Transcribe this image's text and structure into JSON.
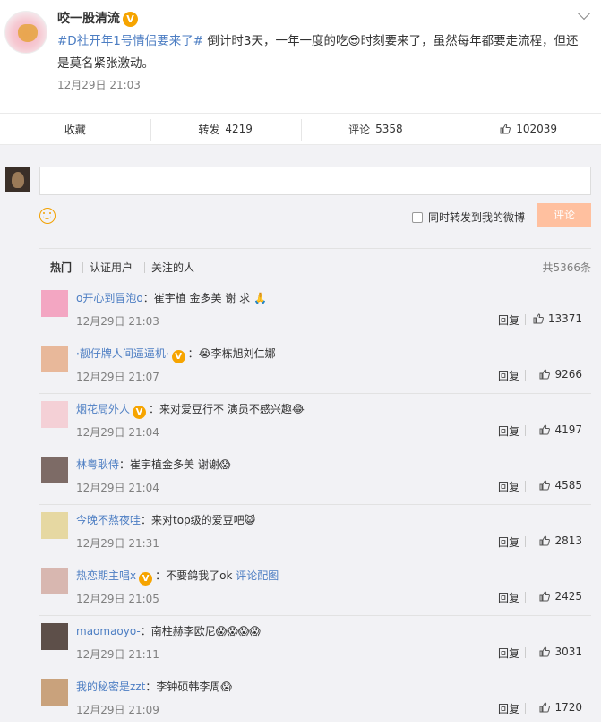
{
  "post": {
    "author": "咬一股清流",
    "verified_badge": "V",
    "hashtag": "#D社开年1号情侣要来了#",
    "text": " 倒计时3天，一年一度的吃😎时刻要来了，虽然每年都要走流程，但还是莫名紧张激动。",
    "time": "12月29日 21:03"
  },
  "actions": {
    "favorite": "收藏",
    "repost_label": "转发",
    "repost_count": "4219",
    "comment_label": "评论",
    "comment_count": "5358",
    "like_count": "102039"
  },
  "composer": {
    "repost_option": "同时转发到我的微博",
    "submit_label": "评论"
  },
  "tabs": {
    "hot": "热门",
    "verified": "认证用户",
    "following": "关注的人",
    "total": "共5366条"
  },
  "comments": [
    {
      "name": "o开心到冒泡o",
      "text": "：崔宇植 金多美 谢 求 🙏",
      "time": "12月29日 21:03",
      "reply": "回复",
      "likes": "13371",
      "avatar_color": "#f3a6c2"
    },
    {
      "name": "·靓仔牌人间逼逼机·",
      "text": "：😭李栋旭刘仁娜",
      "time": "12月29日 21:07",
      "reply": "回复",
      "likes": "9266",
      "avatar_color": "#e8b89a"
    },
    {
      "name": "烟花局外人",
      "text": "：来对爱豆行不 演员不感兴趣😂",
      "time": "12月29日 21:04",
      "reply": "回复",
      "likes": "4197",
      "avatar_color": "#f4d0d6"
    },
    {
      "name": "林粤耿侍",
      "text": "：崔宇植金多美 谢谢😱",
      "time": "12月29日 21:04",
      "reply": "回复",
      "likes": "4585",
      "avatar_color": "#7d6b66"
    },
    {
      "name": "今晚不熬夜哇",
      "text": "：来对top级的爱豆吧😺",
      "time": "12月29日 21:31",
      "reply": "回复",
      "likes": "2813",
      "avatar_color": "#e6d8a2"
    },
    {
      "name": "热恋期主唱x",
      "text": "：不要鸽我了ok",
      "extra": "评论配图",
      "time": "12月29日 21:05",
      "reply": "回复",
      "likes": "2425",
      "avatar_color": "#d8b7b0"
    },
    {
      "name": "maomaoyo-",
      "text": "：南柱赫李欧尼😱😱😱😱",
      "time": "12月29日 21:11",
      "reply": "回复",
      "likes": "3031",
      "avatar_color": "#5d4f49"
    },
    {
      "name": "我的秘密是zzt",
      "text": "：李钟硕韩李周😱",
      "time": "12月29日 21:09",
      "reply": "回复",
      "likes": "1720",
      "avatar_color": "#c9a27c"
    }
  ]
}
